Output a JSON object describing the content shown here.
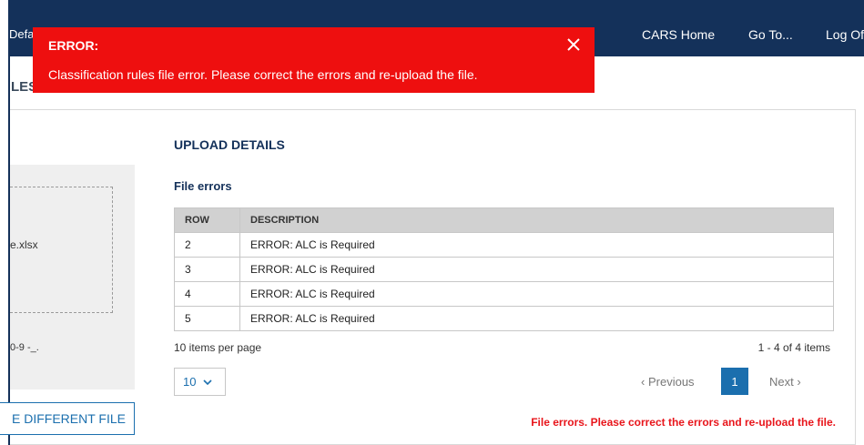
{
  "nav": {
    "brand_fragment": "Defa",
    "links": [
      "CARS Home",
      "Go To...",
      "Log Of"
    ]
  },
  "page": {
    "heading_fragment": "LES"
  },
  "alert": {
    "title": "ERROR:",
    "message": "Classification rules file error. Please correct the errors and re-upload the file.",
    "close_icon": "close-icon"
  },
  "upload": {
    "file_name_fragment": "e.xlsx",
    "allowed_chars_fragment": "0-9 -_.",
    "different_file_label": "E DIFFERENT FILE"
  },
  "details": {
    "section_title": "UPLOAD DETAILS",
    "subsection_title": "File errors",
    "columns": [
      "ROW",
      "DESCRIPTION"
    ],
    "rows": [
      {
        "row": "2",
        "description": "ERROR: ALC is Required"
      },
      {
        "row": "3",
        "description": "ERROR: ALC is Required"
      },
      {
        "row": "4",
        "description": "ERROR: ALC is Required"
      },
      {
        "row": "5",
        "description": "ERROR: ALC is Required"
      }
    ]
  },
  "pagination": {
    "per_page_label": "10 items per page",
    "range_label": "1 - 4 of 4 items",
    "per_page_value": "10",
    "prev_label": "Previous",
    "current_page": "1",
    "next_label": "Next"
  },
  "footer_error": "File errors. Please correct the errors and re-upload the file.",
  "colors": {
    "nav_bg": "#14315a",
    "alert_bg": "#ee0f0f",
    "accent": "#1b6fae",
    "error_text": "#e8151b"
  }
}
